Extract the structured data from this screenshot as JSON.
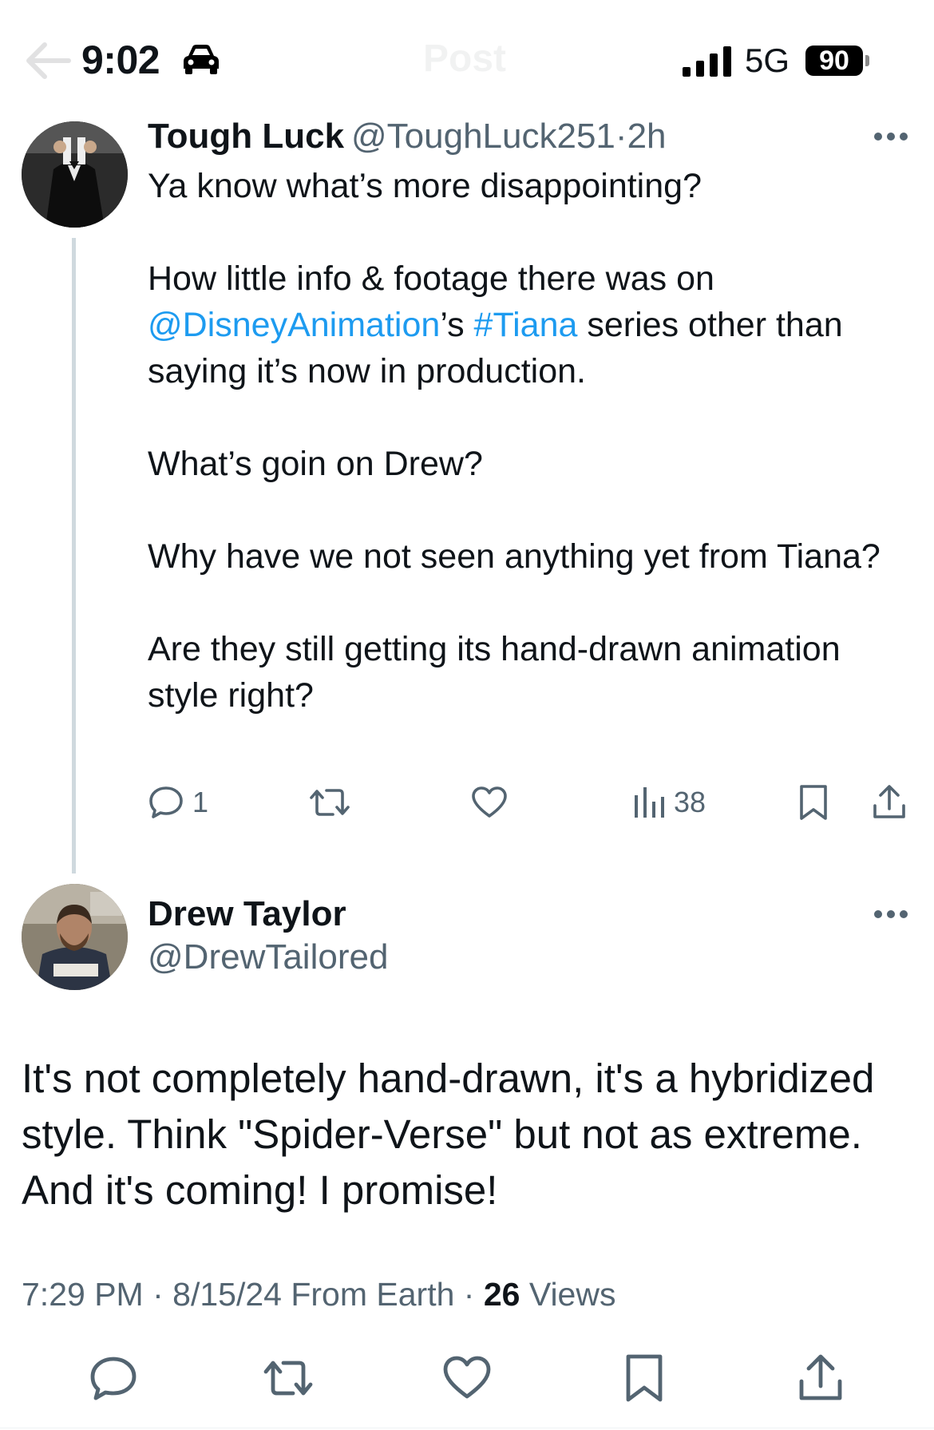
{
  "status_bar": {
    "time": "9:02",
    "network": "5G",
    "battery": "90",
    "icons": [
      "car-icon",
      "signal-icon",
      "battery-icon"
    ]
  },
  "header": {
    "title": "Post",
    "back_icon": "arrow-left-icon"
  },
  "parent_tweet": {
    "display_name": "Tough Luck",
    "handle": "@ToughLuck251",
    "separator": "·",
    "age": "2h",
    "paragraphs": {
      "p1": "Ya know what’s more disappointing?",
      "p2_pre": "How little info & footage there was on ",
      "p2_mention": "@DisneyAnimation",
      "p2_mid": "’s ",
      "p2_hashtag": "#Tiana",
      "p2_post": " series other than saying it’s now in production.",
      "p3": "What’s goin on Drew?",
      "p4": "Why have we not seen anything yet from Tiana?",
      "p5": "Are they still getting its hand-drawn animation style right?"
    },
    "actions": {
      "reply_count": "1",
      "repost_count": "",
      "like_count": "",
      "views_count": "38"
    }
  },
  "main_tweet": {
    "display_name": "Drew Taylor",
    "handle": "@DrewTailored",
    "text": "It's not completely hand-drawn, it's a hybridized style. Think \"Spider-Verse\" but not as extreme. And it's coming! I promise!",
    "time": "7:29 PM",
    "date": "8/15/24",
    "source": "From Earth",
    "views_count": "26",
    "views_label": "Views"
  },
  "colors": {
    "text": "#0f1419",
    "secondary": "#536471",
    "link": "#1d9bf0",
    "thread_line": "#cfd9de"
  }
}
